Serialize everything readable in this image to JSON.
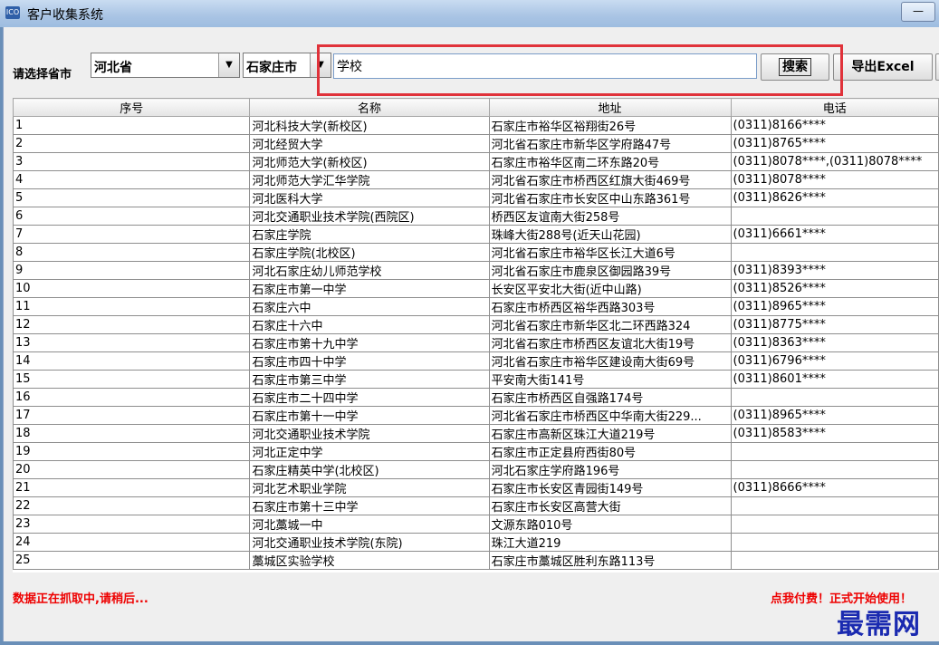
{
  "window": {
    "title": "客户收集系统",
    "icon_label": "ICO",
    "minimize": "—"
  },
  "toolbar": {
    "region_label": "请选择省市",
    "province": "河北省",
    "city": "石家庄市",
    "keyword": "学校",
    "search_label": "搜索",
    "export_label": "导出Excel"
  },
  "table": {
    "columns": [
      "序号",
      "名称",
      "地址",
      "电话"
    ],
    "rows": [
      [
        "1",
        "河北科技大学(新校区)",
        "石家庄市裕华区裕翔街26号",
        "(0311)8166****"
      ],
      [
        "2",
        "河北经贸大学",
        "河北省石家庄市新华区学府路47号",
        "(0311)8765****"
      ],
      [
        "3",
        "河北师范大学(新校区)",
        "石家庄市裕华区南二环东路20号",
        "(0311)8078****,(0311)8078****"
      ],
      [
        "4",
        "河北师范大学汇华学院",
        "河北省石家庄市桥西区红旗大街469号",
        "(0311)8078****"
      ],
      [
        "5",
        "河北医科大学",
        "河北省石家庄市长安区中山东路361号",
        "(0311)8626****"
      ],
      [
        "6",
        "河北交通职业技术学院(西院区)",
        "桥西区友谊南大街258号",
        ""
      ],
      [
        "7",
        "石家庄学院",
        "珠峰大街288号(近天山花园)",
        "(0311)6661****"
      ],
      [
        "8",
        "石家庄学院(北校区)",
        "河北省石家庄市裕华区长江大道6号",
        ""
      ],
      [
        "9",
        "河北石家庄幼儿师范学校",
        "河北省石家庄市鹿泉区御园路39号",
        "(0311)8393****"
      ],
      [
        "10",
        "石家庄市第一中学",
        "长安区平安北大街(近中山路)",
        "(0311)8526****"
      ],
      [
        "11",
        "石家庄六中",
        "石家庄市桥西区裕华西路303号",
        "(0311)8965****"
      ],
      [
        "12",
        "石家庄十六中",
        "河北省石家庄市新华区北二环西路324",
        "(0311)8775****"
      ],
      [
        "13",
        "石家庄市第十九中学",
        "河北省石家庄市桥西区友谊北大街19号",
        "(0311)8363****"
      ],
      [
        "14",
        "石家庄市四十中学",
        "河北省石家庄市裕华区建设南大街69号",
        "(0311)6796****"
      ],
      [
        "15",
        "石家庄市第三中学",
        "平安南大街141号",
        "(0311)8601****"
      ],
      [
        "16",
        "石家庄市二十四中学",
        "石家庄市桥西区自强路174号",
        ""
      ],
      [
        "17",
        "石家庄市第十一中学",
        "河北省石家庄市桥西区中华南大街229...",
        "(0311)8965****"
      ],
      [
        "18",
        "河北交通职业技术学院",
        "石家庄市高新区珠江大道219号",
        "(0311)8583****"
      ],
      [
        "19",
        "河北正定中学",
        "石家庄市正定县府西街80号",
        ""
      ],
      [
        "20",
        "石家庄精英中学(北校区)",
        "河北石家庄学府路196号",
        ""
      ],
      [
        "21",
        "河北艺术职业学院",
        "石家庄市长安区青园街149号",
        "(0311)8666****"
      ],
      [
        "22",
        "石家庄市第十三中学",
        "石家庄市长安区高营大街",
        ""
      ],
      [
        "23",
        "河北藁城一中",
        "文源东路010号",
        ""
      ],
      [
        "24",
        "河北交通职业技术学院(东院)",
        "珠江大道219",
        ""
      ],
      [
        "25",
        "藁城区实验学校",
        "石家庄市藁城区胜利东路113号",
        ""
      ]
    ]
  },
  "status": {
    "message": "数据正在抓取中,请稍后...",
    "pay_link": "点我付费！正式开始使用！"
  },
  "watermark": "最需网"
}
